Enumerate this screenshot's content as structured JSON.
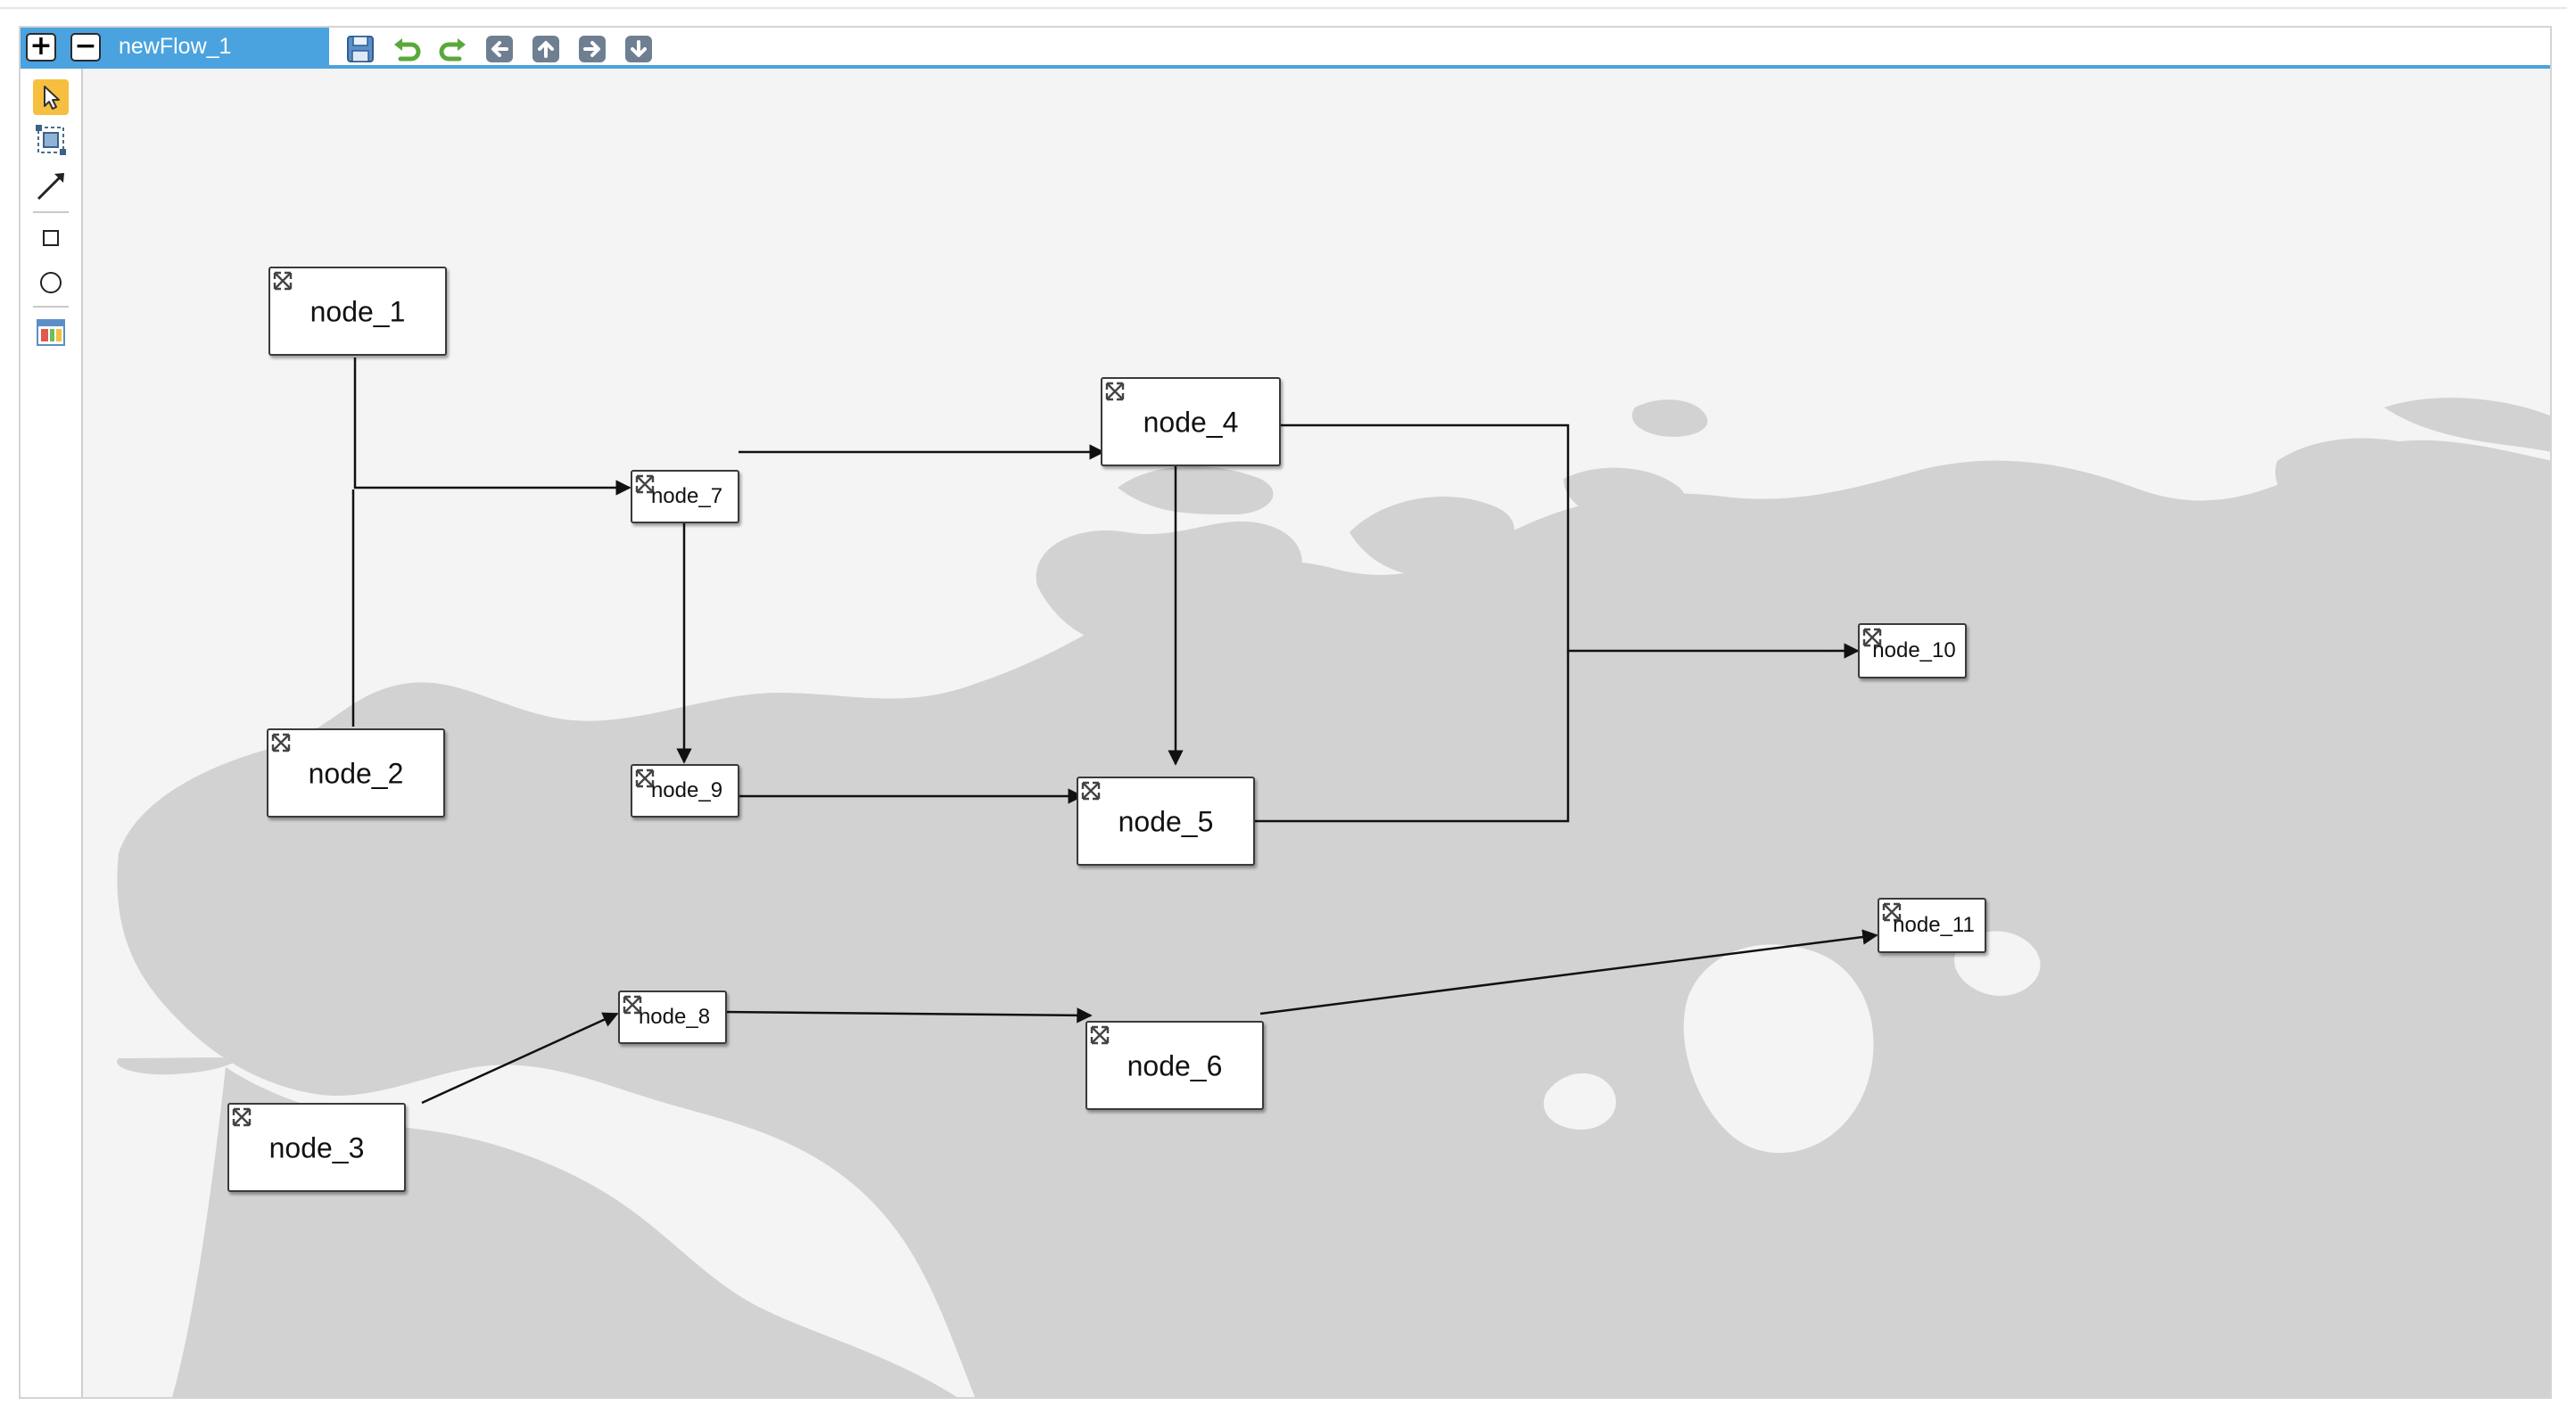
{
  "titlebar": {
    "add_button_glyph": "+",
    "remove_button_glyph": "−",
    "flow_name": "newFlow_1",
    "accent_color": "#4aa3df",
    "tools": [
      {
        "name": "save-icon"
      },
      {
        "name": "undo-icon"
      },
      {
        "name": "redo-icon"
      },
      {
        "name": "arrow-left-icon"
      },
      {
        "name": "arrow-up-icon"
      },
      {
        "name": "arrow-right-icon"
      },
      {
        "name": "arrow-down-icon"
      }
    ]
  },
  "toolbox": {
    "items": [
      {
        "name": "select-pointer-icon",
        "active": true
      },
      {
        "name": "multi-select-icon",
        "active": false
      },
      {
        "name": "connector-line-icon",
        "active": false
      },
      {
        "name": "rectangle-node-icon",
        "active": false
      },
      {
        "name": "circle-node-icon",
        "active": false
      },
      {
        "name": "swimlane-icon",
        "active": false
      }
    ],
    "active_color": "#f6bf3f"
  },
  "diagram": {
    "nodes": [
      {
        "id": "node_1",
        "label": "node_1"
      },
      {
        "id": "node_2",
        "label": "node_2"
      },
      {
        "id": "node_3",
        "label": "node_3"
      },
      {
        "id": "node_4",
        "label": "node_4"
      },
      {
        "id": "node_5",
        "label": "node_5"
      },
      {
        "id": "node_6",
        "label": "node_6"
      },
      {
        "id": "node_7",
        "label": "node_7"
      },
      {
        "id": "node_8",
        "label": "node_8"
      },
      {
        "id": "node_9",
        "label": "node_9"
      },
      {
        "id": "node_10",
        "label": "node_10"
      },
      {
        "id": "node_11",
        "label": "node_11"
      }
    ],
    "edges": [
      {
        "from": "node_1",
        "to": "node_7"
      },
      {
        "from": "node_2",
        "to": "node_7"
      },
      {
        "from": "node_7",
        "to": "node_4"
      },
      {
        "from": "node_7",
        "to": "node_9"
      },
      {
        "from": "node_9",
        "to": "node_5"
      },
      {
        "from": "node_4",
        "to": "node_5"
      },
      {
        "from": "node_4",
        "to": "node_10"
      },
      {
        "from": "node_5",
        "to": "node_10"
      },
      {
        "from": "node_3",
        "to": "node_8"
      },
      {
        "from": "node_8",
        "to": "node_6"
      },
      {
        "from": "node_6",
        "to": "node_11"
      }
    ],
    "map_color": "#d2d2d2",
    "canvas_color": "#f4f4f4"
  }
}
